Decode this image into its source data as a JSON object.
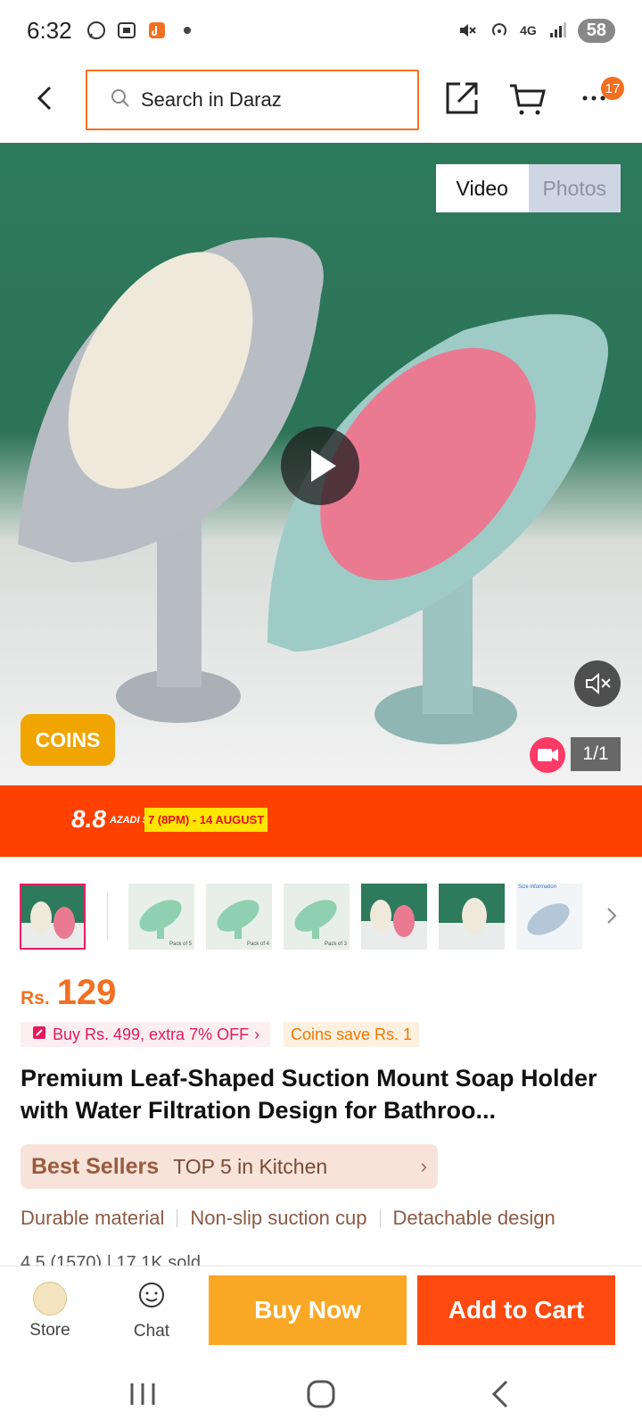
{
  "status_bar": {
    "time": "6:32",
    "icons": [
      "whatsapp-icon",
      "scan-icon",
      "app-icon",
      "dot-icon"
    ],
    "right_icons": [
      "mute-icon",
      "hotspot-icon",
      "signal-icon"
    ],
    "network": "4G",
    "battery": "58"
  },
  "header": {
    "search_placeholder": "Search in Daraz",
    "cart_badge": "17"
  },
  "media": {
    "tab_video": "Video",
    "tab_photos": "Photos",
    "coins_label": "COINS",
    "counter": "1/1"
  },
  "banner": {
    "logo_num": "8.8",
    "logo_words": "AZADI SALE",
    "dates": "7 (8PM) - 14 AUGUST"
  },
  "thumbnails": [
    "Pack of 5",
    "Pack of 4",
    "Pack of 3",
    "Size information"
  ],
  "price": {
    "currency": "Rs.",
    "value": "129",
    "promo": "Buy Rs. 499, extra 7% OFF",
    "coins_save": "Coins save Rs. 1"
  },
  "product": {
    "title": "Premium Leaf-Shaped Suction Mount Soap Holder with Water Filtration Design for Bathroo..."
  },
  "best_seller": {
    "tag": "Best Sellers",
    "text": "TOP 5 in Kitchen"
  },
  "features": [
    "Durable material",
    "Non-slip suction cup",
    "Detachable design"
  ],
  "rating_peek": "4.5 (1570) | 17.1K sold",
  "bottom_bar": {
    "store_label": "Store",
    "chat_label": "Chat",
    "buy_now": "Buy Now",
    "add_to_cart": "Add to Cart"
  },
  "colors": {
    "accent": "#f36f21",
    "buy_now": "#f9a825",
    "add_to_cart": "#fe4a0f",
    "banner": "#fe4100"
  }
}
